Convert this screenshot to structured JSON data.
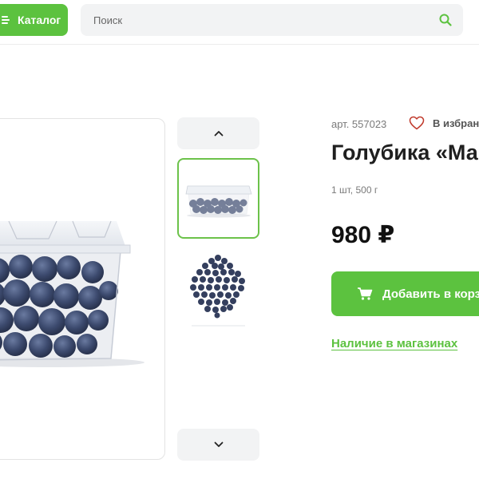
{
  "header": {
    "catalog_label": "Каталог",
    "search_placeholder": "Поиск"
  },
  "product": {
    "article": "арт. 557023",
    "favorite_label": "В избран",
    "title": "Голубика «Ма",
    "pack_info": "1 шт, 500 г",
    "price": "980 ₽",
    "add_to_cart_label": "Добавить в корз",
    "stores_link": "Наличие в магазинах"
  },
  "gallery": {
    "thumbnails": [
      "blueberries-in-plastic-container",
      "loose-blueberries-pile"
    ],
    "selected_index": 0
  },
  "colors": {
    "accent_green": "#5cc23f",
    "search_bg": "#f2f3f4",
    "blueberry": "#3c4a6e"
  }
}
